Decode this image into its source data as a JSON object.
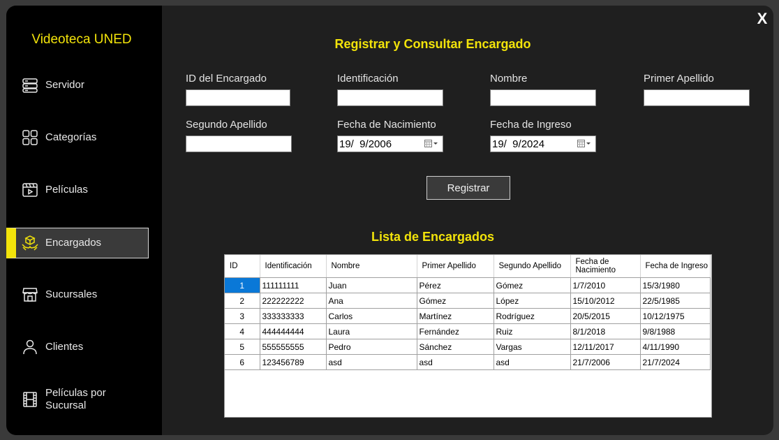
{
  "sidebar": {
    "title": "Videoteca UNED",
    "items": [
      {
        "label": "Servidor",
        "icon": "server-icon"
      },
      {
        "label": "Categorías",
        "icon": "grid-icon"
      },
      {
        "label": "Películas",
        "icon": "clapperboard-icon"
      },
      {
        "label": "Encargados",
        "icon": "hands-box-icon",
        "active": true
      },
      {
        "label": "Sucursales",
        "icon": "store-icon"
      },
      {
        "label": "Clientes",
        "icon": "user-icon"
      },
      {
        "label": "Películas por Sucursal",
        "icon": "film-strip-icon"
      }
    ]
  },
  "window": {
    "close_label": "X"
  },
  "form": {
    "title": "Registrar y Consultar Encargado",
    "id_label": "ID del Encargado",
    "id_value": "",
    "identificacion_label": "Identificación",
    "identificacion_value": "",
    "nombre_label": "Nombre",
    "nombre_value": "",
    "primer_apellido_label": "Primer Apellido",
    "primer_apellido_value": "",
    "segundo_apellido_label": "Segundo Apellido",
    "segundo_apellido_value": "",
    "fecha_nacimiento_label": "Fecha de Nacimiento",
    "fecha_nacimiento_value": "19/  9/2006",
    "fecha_ingreso_label": "Fecha de Ingreso",
    "fecha_ingreso_value": "19/  9/2024",
    "register_label": "Registrar"
  },
  "list": {
    "title": "Lista de Encargados",
    "columns": [
      "ID",
      "Identificación",
      "Nombre",
      "Primer Apellido",
      "Segundo Apellido",
      "Fecha de Nacimiento",
      "Fecha de Ingreso"
    ],
    "rows": [
      [
        "1",
        "111111111",
        "Juan",
        "Pérez",
        "Gómez",
        "1/7/2010",
        "15/3/1980"
      ],
      [
        "2",
        "222222222",
        "Ana",
        "Gómez",
        "López",
        "15/10/2012",
        "22/5/1985"
      ],
      [
        "3",
        "333333333",
        "Carlos",
        "Martínez",
        "Rodríguez",
        "20/5/2015",
        "10/12/1975"
      ],
      [
        "4",
        "444444444",
        "Laura",
        "Fernández",
        "Ruiz",
        "8/1/2018",
        "9/8/1988"
      ],
      [
        "5",
        "555555555",
        "Pedro",
        "Sánchez",
        "Vargas",
        "12/11/2017",
        "4/11/1990"
      ],
      [
        "6",
        "123456789",
        "asd",
        "asd",
        "asd",
        "21/7/2006",
        "21/7/2024"
      ]
    ],
    "selected_row": 0
  },
  "colors": {
    "accent": "#f2e30a",
    "selection": "#0a78d7",
    "sidebar_bg": "#000000",
    "content_bg": "#1f1f1f"
  }
}
